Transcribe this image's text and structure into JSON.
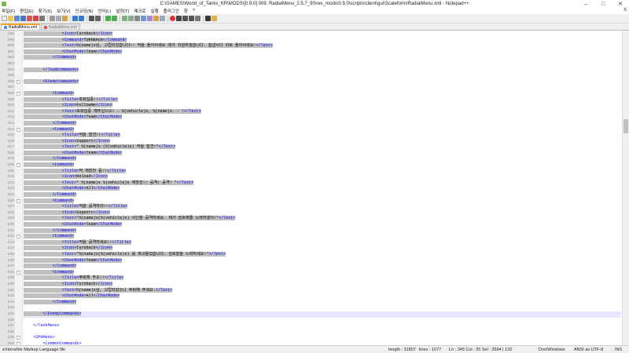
{
  "window": {
    "title": "C:\\GAMES\\World_of_Tanks_KR\\MODS\\[0.9.0] 009. RadialMenu_2.5.7_90\\res_mods\\0.9.0\\scripts\\client\\gui\\Scaleform\\RadialMenu.xml - Notepad++",
    "controls": {
      "minimize": "–",
      "maximize": "□",
      "close": "✕"
    }
  },
  "menu": {
    "items": [
      "파일(F)",
      "편집(E)",
      "찾기(S)",
      "보기(V)",
      "인코딩(N)",
      "언어(L)",
      "설정(T)",
      "매크로",
      "실행",
      "플러그인",
      "창",
      "?"
    ],
    "close_x": "X"
  },
  "tabs": [
    {
      "label": "RadialMenu.xml",
      "active": true
    },
    {
      "label": "RadialMenu.xml",
      "active": false
    }
  ],
  "editor": {
    "lines": [
      {
        "n": "298",
        "t": "                <Icon>Turnback</Icon>",
        "s": true
      },
      {
        "n": "299",
        "t": "                <Command>TURNBACK</Command>",
        "s": true
      },
      {
        "n": "300",
        "t": "                <Text>%(name)s님, 고립되었습니다!! 적을 돌아서세요 제가 지원하겠습니다. 힘냅시다 외로 돌아서세요!</Text>",
        "s": true
      },
      {
        "n": "301",
        "t": "                <ChatMode>Team</ChatMode>",
        "s": true
      },
      {
        "n": "302",
        "t": "            </Command>",
        "s": true
      },
      {
        "n": "303",
        "t": "",
        "s": true
      },
      {
        "n": "304",
        "t": "        </TeamCommands>",
        "s": true
      },
      {
        "n": "305",
        "t": "",
        "s": true
      },
      {
        "n": "306",
        "t": "        <EnemyCommands>",
        "s": true,
        "f": true
      },
      {
        "n": "307",
        "t": "",
        "s": true
      },
      {
        "n": "308",
        "t": "            <Command>",
        "s": true,
        "f": true
      },
      {
        "n": "309",
        "t": "                <Title>포화집중!!</Title>",
        "s": true
      },
      {
        "n": "310",
        "t": "                <Icon>Followme</Icon>",
        "s": true
      },
      {
        "n": "311",
        "t": "                <Text>포화집중 해주십시오! - %(vehicle)s, %(name)s. - !</Text>",
        "s": true
      },
      {
        "n": "312",
        "t": "                <ChatMode>Team</ChatMode>",
        "s": true
      },
      {
        "n": "313",
        "t": "            </Command>",
        "s": true
      },
      {
        "n": "314",
        "t": "            <Command>",
        "s": true,
        "f": true
      },
      {
        "n": "315",
        "t": "                <Title>적을 발견!!</Title>",
        "s": true
      },
      {
        "n": "316",
        "t": "                <Icon>Support</Icon>",
        "s": true
      },
      {
        "n": "317",
        "t": "                <Text>* %(name)s (%(vehicle)s) 적을 발견!*</Text>",
        "s": true
      },
      {
        "n": "318",
        "t": "                <ChatMode>Team</ChatMode>",
        "s": true
      },
      {
        "n": "319",
        "t": "            </Command>",
        "s": true
      },
      {
        "n": "320",
        "t": "            <Command>",
        "s": true,
        "f": true
      },
      {
        "n": "321",
        "t": "                <Title>적 재장전 중!!</Title>",
        "s": true
      },
      {
        "n": "322",
        "t": "                <Icon>Reload</Icon>",
        "s": true
      },
      {
        "n": "323",
        "t": "                <Text>* %(name)s %(vehicle)s 재장전!! 공격! 공격! *</Text>",
        "s": true
      },
      {
        "n": "324",
        "t": "                <ChatMode>All</ChatMode>",
        "s": true
      },
      {
        "n": "325",
        "t": "            </Command>",
        "s": true
      },
      {
        "n": "326",
        "t": "            <Command>",
        "s": true,
        "f": true
      },
      {
        "n": "327",
        "t": "                <Title>적을 공격하라!!</Title>",
        "s": true
      },
      {
        "n": "328",
        "t": "                <Icon>Support</Icon>",
        "s": true
      },
      {
        "n": "329",
        "t": "                <Text>*%(name)s(%(vehicle)s) 사신을 공격하세요. 제가 엄호해줄 노력하겠어!*</Text>",
        "s": true
      },
      {
        "n": "330",
        "t": "                <ChatMode>Team</ChatMode>",
        "s": true
      },
      {
        "n": "331",
        "t": "            </Command>",
        "s": true
      },
      {
        "n": "332",
        "t": "            <Command>",
        "s": true,
        "f": true
      },
      {
        "n": "333",
        "t": "                <Title>적을 공격하세요!!</Title>",
        "s": true
      },
      {
        "n": "334",
        "t": "                <Icon>Turnback</Icon>",
        "s": true
      },
      {
        "n": "335",
        "t": "                <Text>*%(name)s(%(vehicle)s) 를 파고들었습니다. 엄호할을 노력하세요!*</Text>",
        "s": true
      },
      {
        "n": "336",
        "t": "                <ChatMode>Team</ChatMode>",
        "s": true
      },
      {
        "n": "337",
        "t": "            </Command>",
        "s": true
      },
      {
        "n": "338",
        "t": "            <Command>",
        "s": true,
        "f": true
      },
      {
        "n": "339",
        "t": "                <Title>후퇴해 주오!!</Title>",
        "s": true
      },
      {
        "n": "340",
        "t": "                <Icon>Turnback</Icon>",
        "s": true
      },
      {
        "n": "341",
        "t": "                <Text>%(name)s님, 고립되었으니 후퇴해 주세요.</Text>",
        "s": true
      },
      {
        "n": "342",
        "t": "                <ChatMode>All</ChatMode>",
        "s": true
      },
      {
        "n": "343",
        "t": "            </Command>",
        "s": true
      },
      {
        "n": "344",
        "t": "",
        "s": true
      },
      {
        "n": "345",
        "t": "        </EnemyCommands>",
        "s": true,
        "cur": true
      },
      {
        "n": "346",
        "t": "",
        "s": false
      },
      {
        "n": "347",
        "t": "    </TankMenu>",
        "s": false
      },
      {
        "n": "348",
        "t": "",
        "s": false
      },
      {
        "n": "349",
        "t": "    <SPGMenu>",
        "s": false,
        "f": true
      },
      {
        "n": "350",
        "t": "        <CommonCommands>",
        "s": false,
        "f": true
      }
    ]
  },
  "status": {
    "filetype": "eXtensible Markup Language file",
    "length": "length : 31807",
    "lines": "lines : 1077",
    "pos": "Ln : 345   Col : 25   Sel : 3594 | 132",
    "eol": "Dos\\Windows",
    "enc": "ANSI as UTF-8",
    "mode": "INS"
  },
  "colors": {
    "tag": "#0000ff",
    "selection": "#c0c0c0",
    "accent": "#f5a623"
  }
}
